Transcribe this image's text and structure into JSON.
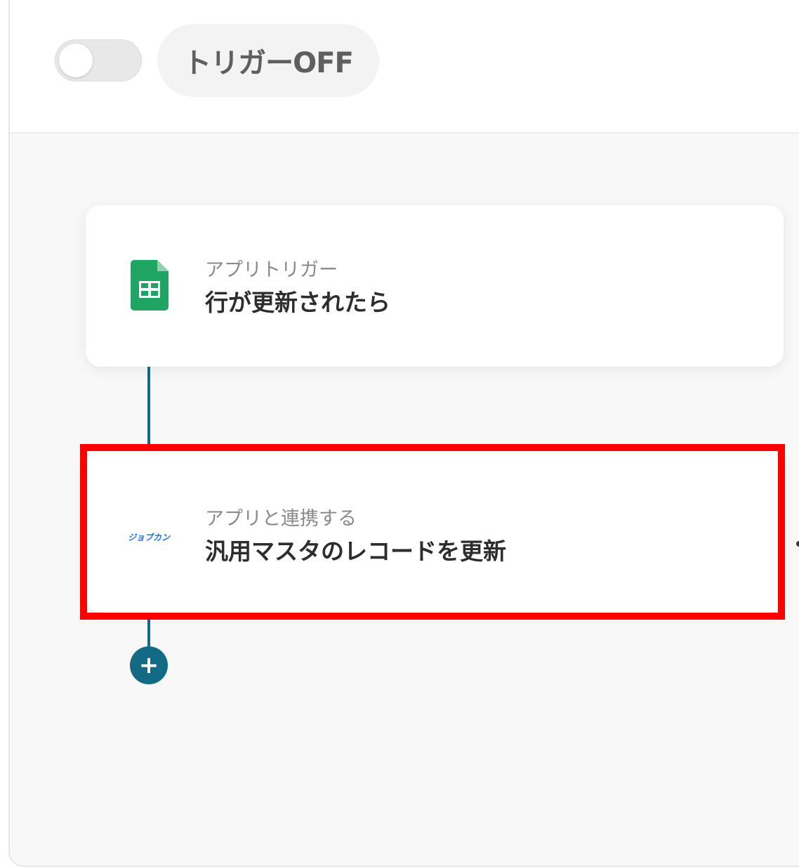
{
  "header": {
    "toggle_state": "off",
    "status_label": "トリガーOFF"
  },
  "flow": {
    "steps": [
      {
        "type_label": "アプリトリガー",
        "title": "行が更新されたら",
        "icon": "google-sheets-icon"
      },
      {
        "type_label": "アプリと連携する",
        "title": "汎用マスタのレコードを更新",
        "icon": "jobkan-logo",
        "logo_text": "ジョブカン",
        "highlighted": true
      }
    ],
    "add_button_label": "+"
  },
  "colors": {
    "connector": "#136a84",
    "highlight": "#ff0000",
    "sheets_green": "#1fa463",
    "jobkan_blue": "#1f6fe0"
  }
}
